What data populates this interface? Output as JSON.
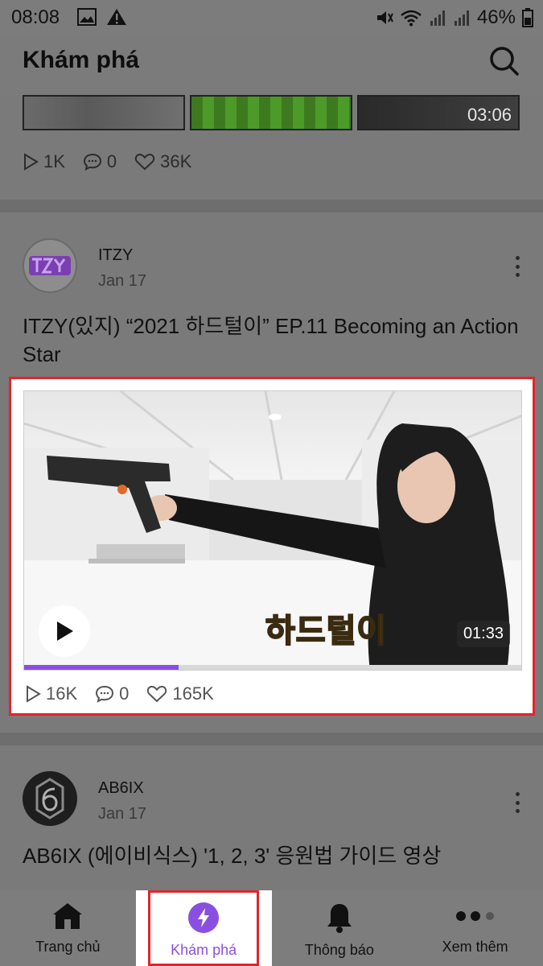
{
  "status_bar": {
    "time": "08:08",
    "battery": "46%",
    "icons": [
      "image-icon",
      "warning-icon",
      "mute-icon",
      "wifi-icon",
      "signal-icon",
      "signal-icon",
      "battery-icon"
    ]
  },
  "header": {
    "title": "Khám phá",
    "search_icon": "search-icon"
  },
  "feed": {
    "prev_post": {
      "duration": "03:06",
      "stats": {
        "plays": "1K",
        "comments": "0",
        "likes": "36K"
      }
    },
    "post_itzy": {
      "author": "ITZY",
      "date": "Jan 17",
      "title": "ITZY(있지) “2021 하드털이” EP.11 Becoming an Action Star",
      "video": {
        "duration": "01:33",
        "overlay_text": "하드털이",
        "progress": 0.31
      },
      "stats": {
        "plays": "16K",
        "comments": "0",
        "likes": "165K"
      }
    },
    "post_ab6ix": {
      "author": "AB6IX",
      "date": "Jan 17",
      "title": "AB6IX (에이비식스) '1, 2, 3' 응원법 가이드 영상"
    }
  },
  "bottom_nav": {
    "items": [
      {
        "label": "Trang chủ",
        "icon": "home-icon"
      },
      {
        "label": "Khám phá",
        "icon": "explore-icon",
        "active": true
      },
      {
        "label": "Thông báo",
        "icon": "bell-icon"
      },
      {
        "label": "Xem thêm",
        "icon": "more-icon"
      }
    ]
  },
  "colors": {
    "accent": "#8a4fe0",
    "highlight_border": "#e3242b",
    "dim_background": "#7c7c7c"
  }
}
